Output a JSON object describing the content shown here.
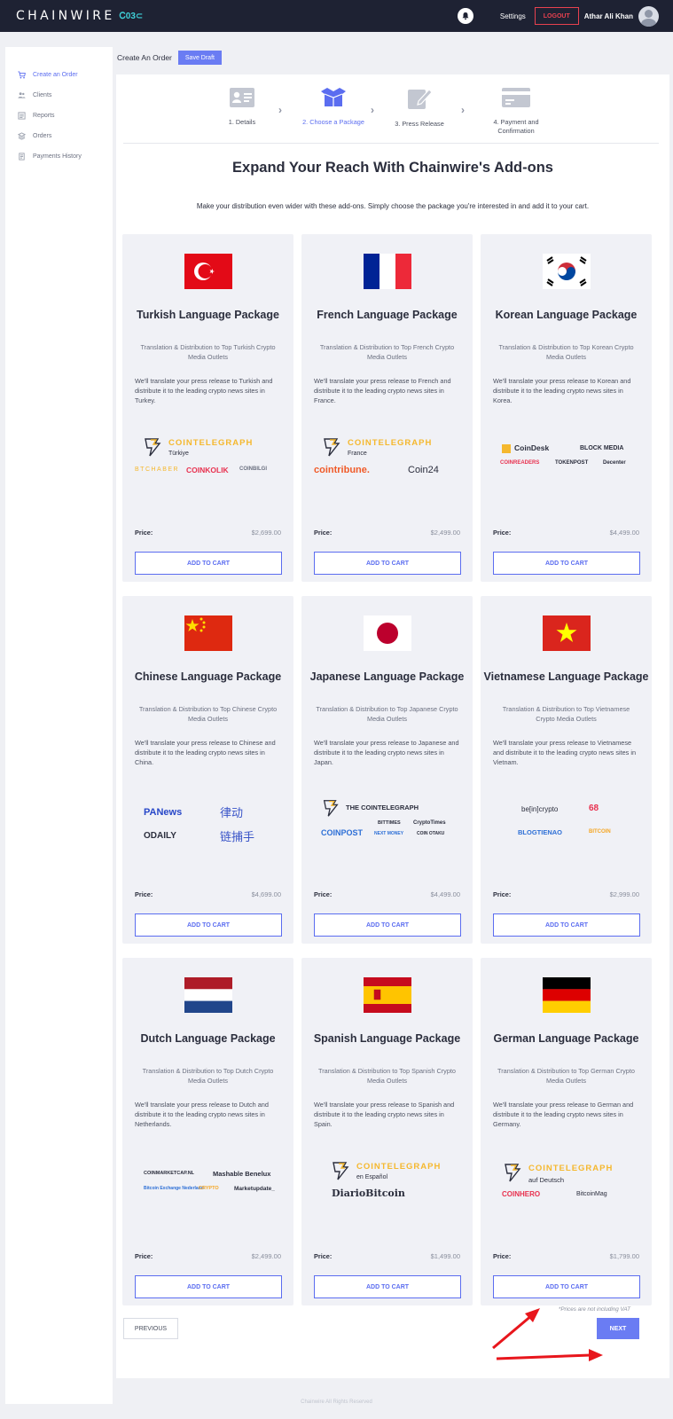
{
  "topbar": {
    "logo": "CHAINWIRE",
    "logo_badge": "Ꮯ03⊂",
    "settings": "Settings",
    "logout": "LOGOUT",
    "username": "Athar Ali Khan"
  },
  "sidebar": {
    "items": [
      {
        "label": "Create an Order",
        "icon": "cart-icon"
      },
      {
        "label": "Clients",
        "icon": "users-icon"
      },
      {
        "label": "Reports",
        "icon": "reports-icon"
      },
      {
        "label": "Orders",
        "icon": "orders-icon"
      },
      {
        "label": "Payments History",
        "icon": "receipt-icon"
      }
    ]
  },
  "header": {
    "title": "Create An Order",
    "save_draft": "Save Draft"
  },
  "steps": [
    {
      "label": "1. Details"
    },
    {
      "label": "2. Choose a Package"
    },
    {
      "label": "3. Press Release"
    },
    {
      "label": "4. Payment and Confirmation"
    }
  ],
  "headline": "Expand Your Reach With Chainwire's Add-ons",
  "subline": "Make your distribution even wider with these add-ons. Simply choose the package you're interested in and add it to your cart.",
  "price_label": "Price:",
  "cart_label": "ADD TO CART",
  "packages": [
    {
      "title": "Turkish Language Package",
      "sub": "Translation & Distribution to Top Turkish Crypto Media Outlets",
      "desc": "We'll translate your press release to Turkish and distribute it to the leading crypto news sites in Turkey.",
      "price": "$2,699.00",
      "logos": [
        "COINTELEGRAPH",
        "Türkiye",
        "BTCHABER",
        "COINKOLIK",
        "COINBILGI"
      ]
    },
    {
      "title": "French Language Package",
      "sub": "Translation & Distribution to Top French Crypto Media Outlets",
      "desc": "We'll translate your press release to French and distribute it to the leading crypto news sites in France.",
      "price": "$2,499.00",
      "logos": [
        "COINTELEGRAPH",
        "France",
        "cointribune.",
        "Coin24"
      ]
    },
    {
      "title": "Korean Language Package",
      "sub": "Translation & Distribution to Top Korean Crypto Media Outlets",
      "desc": "We'll translate your press release to Korean and distribute it to the leading crypto news sites in Korea.",
      "price": "$4,499.00",
      "logos": [
        "CoinDesk",
        "BLOCK MEDIA",
        "COINREADERS",
        "TOKENPOST",
        "Decenter"
      ]
    },
    {
      "title": "Chinese Language Package",
      "sub": "Translation & Distribution to Top Chinese Crypto Media Outlets",
      "desc": "We'll translate your press release to Chinese and distribute it to the leading crypto news sites in China.",
      "price": "$4,699.00",
      "logos": [
        "PANews",
        "律动",
        "ODAILY",
        "链捕手"
      ]
    },
    {
      "title": "Japanese Language Package",
      "sub": "Translation & Distribution to Top Japanese Crypto Media Outlets",
      "desc": "We'll translate your press release to Japanese and distribute it to the leading crypto news sites in Japan.",
      "price": "$4,499.00",
      "logos": [
        "THE COINTELEGRAPH",
        "BITTIMES",
        "CryptoTimes",
        "COINPOST",
        "NEXT MONEY",
        "COIN OTAKU"
      ]
    },
    {
      "title": "Vietnamese Language Package",
      "sub": "Translation & Distribution to Top Vietnamese Crypto Media Outlets",
      "desc": "We'll translate your press release to Vietnamese and distribute it to the leading crypto news sites in Vietnam.",
      "price": "$2,999.00",
      "logos": [
        "be[in]crypto",
        "68",
        "BLOGTIENAO",
        "BITCOIN"
      ]
    },
    {
      "title": "Dutch Language Package",
      "sub": "Translation & Distribution to Top Dutch Crypto Media Outlets",
      "desc": "We'll translate your press release to Dutch and distribute it to the leading crypto news sites in Netherlands.",
      "price": "$2,499.00",
      "logos": [
        "COINMARKETCAP.NL",
        "Mashable Benelux",
        "Bitcoin Exchange Nederland",
        "CRYPTO",
        "Marketupdate_"
      ]
    },
    {
      "title": "Spanish Language Package",
      "sub": "Translation & Distribution to Top Spanish Crypto Media Outlets",
      "desc": "We'll translate your press release to Spanish and distribute it to the leading crypto news sites in Spain.",
      "price": "$1,499.00",
      "logos": [
        "COINTELEGRAPH",
        "en Español",
        "DiarioBitcoin"
      ]
    },
    {
      "title": "German Language Package",
      "sub": "Translation & Distribution to Top German Crypto Media Outlets",
      "desc": "We'll translate your press release to German and distribute it to the leading crypto news sites in Germany.",
      "price": "$1,799.00",
      "logos": [
        "COINTELEGRAPH",
        "auf Deutsch",
        "COINHERO",
        "BitcoinMag"
      ]
    }
  ],
  "note": "*Prices are not including VAT",
  "prev": "PREVIOUS",
  "next": "NEXT",
  "footer": "Chainwire All Rights Reserved",
  "colors": {
    "accent": "#6a7cf3",
    "topbar": "#1e2233",
    "logout": "#e8414f",
    "annotation": "#e8161c"
  }
}
